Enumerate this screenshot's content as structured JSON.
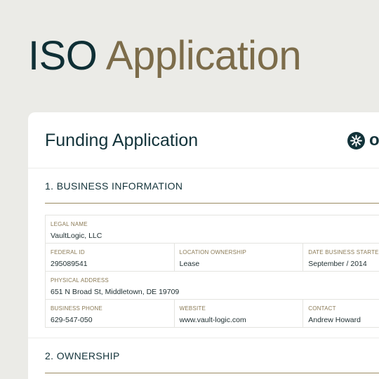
{
  "hero": {
    "word1": "ISO",
    "word2": "Application"
  },
  "card": {
    "title": "Funding Application",
    "logo": {
      "icon": "snowflake-badge-icon",
      "text": "o"
    }
  },
  "sections": [
    {
      "title": "1. BUSINESS INFORMATION"
    },
    {
      "title": "2. OWNERSHIP"
    }
  ],
  "business": {
    "legal_name": {
      "label": "LEGAL NAME",
      "value": "VaultLogic, LLC"
    },
    "federal_id": {
      "label": "FEDERAL ID",
      "value": "295089541"
    },
    "location_ownership": {
      "label": "LOCATION OWNERSHIP",
      "value": "Lease"
    },
    "date_started": {
      "label": "DATE BUSINESS STARTED",
      "value": "September / 2014"
    },
    "physical_address": {
      "label": "PHYSICAL ADDRESS",
      "value": "651 N Broad St, Middletown, DE 19709"
    },
    "business_phone": {
      "label": "BUSINESS PHONE",
      "value": "629-547-050"
    },
    "website": {
      "label": "WEBSITE",
      "value": "www.vault-logic.com"
    },
    "contact": {
      "label": "CONTACT",
      "value": "Andrew Howard"
    }
  },
  "colors": {
    "background": "#ebebe7",
    "navy": "#13333a",
    "gold": "#7c6c4a",
    "card": "#ffffff"
  }
}
